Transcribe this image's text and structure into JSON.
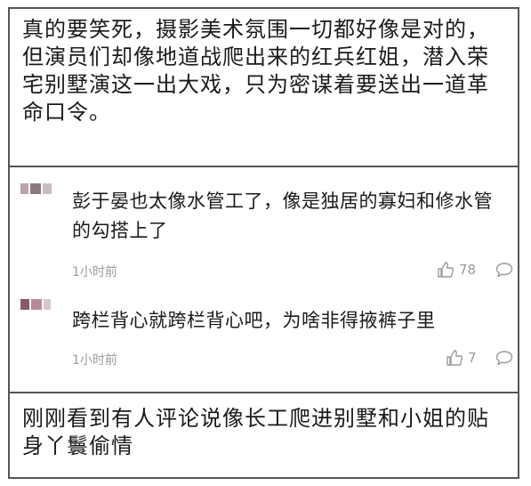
{
  "post_top": {
    "text": "真的要笑死，摄影美术氛围一切都好像是对的，但演员们却像地道战爬出来的红兵红姐，潜入荣宅别墅演这一出大戏，只为密谋着要送出一道革命口令。"
  },
  "comments": [
    {
      "text": "彭于晏也太像水管工了，像是独居的寡妇和修水管的勾搭上了",
      "time": "1小时前",
      "likes": "78"
    },
    {
      "text": "跨栏背心就跨栏背心吧，为啥非得掖裤子里",
      "time": "1小时前",
      "likes": "7"
    }
  ],
  "post_bottom": {
    "text": "刚刚看到有人评论说像长工爬进别墅和小姐的贴身丫鬟偷情"
  },
  "icons": {
    "like": "thumbs-up-icon",
    "reply": "comment-bubble-icon"
  },
  "colors": {
    "text": "#1a1a1a",
    "meta": "#9a9a9a",
    "border": "#555555"
  }
}
